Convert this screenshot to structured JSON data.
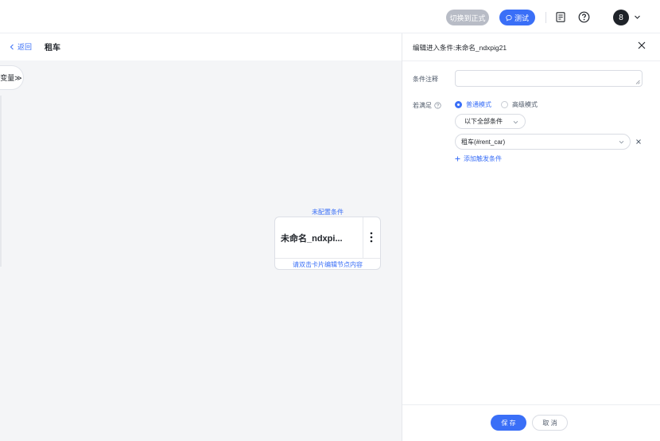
{
  "topbar": {
    "switch_label": "切换到正式",
    "test_label": "测试",
    "avatar_text": "8"
  },
  "subbar": {
    "back_label": "返回",
    "page_title": "租车"
  },
  "canvas": {
    "variable_tab": "变量≫",
    "node": {
      "hint": "未配置条件",
      "title": "未命名_ndxpi...",
      "footer": "请双击卡片编辑节点内容"
    }
  },
  "panel": {
    "title": "编辑进入条件:未命名_ndxpig21",
    "note_label": "条件注释",
    "note_value": "",
    "condition_label": "若满足",
    "mode_normal": "普通模式",
    "mode_advanced": "高级模式",
    "match_select": "以下全部条件",
    "condition_select": "租车(#rent_car)",
    "add_condition": "添加触发条件",
    "save_label": "保 存",
    "cancel_label": "取 消"
  },
  "colors": {
    "accent": "#3a6ff7",
    "switch_bg": "#b8bcc6"
  }
}
